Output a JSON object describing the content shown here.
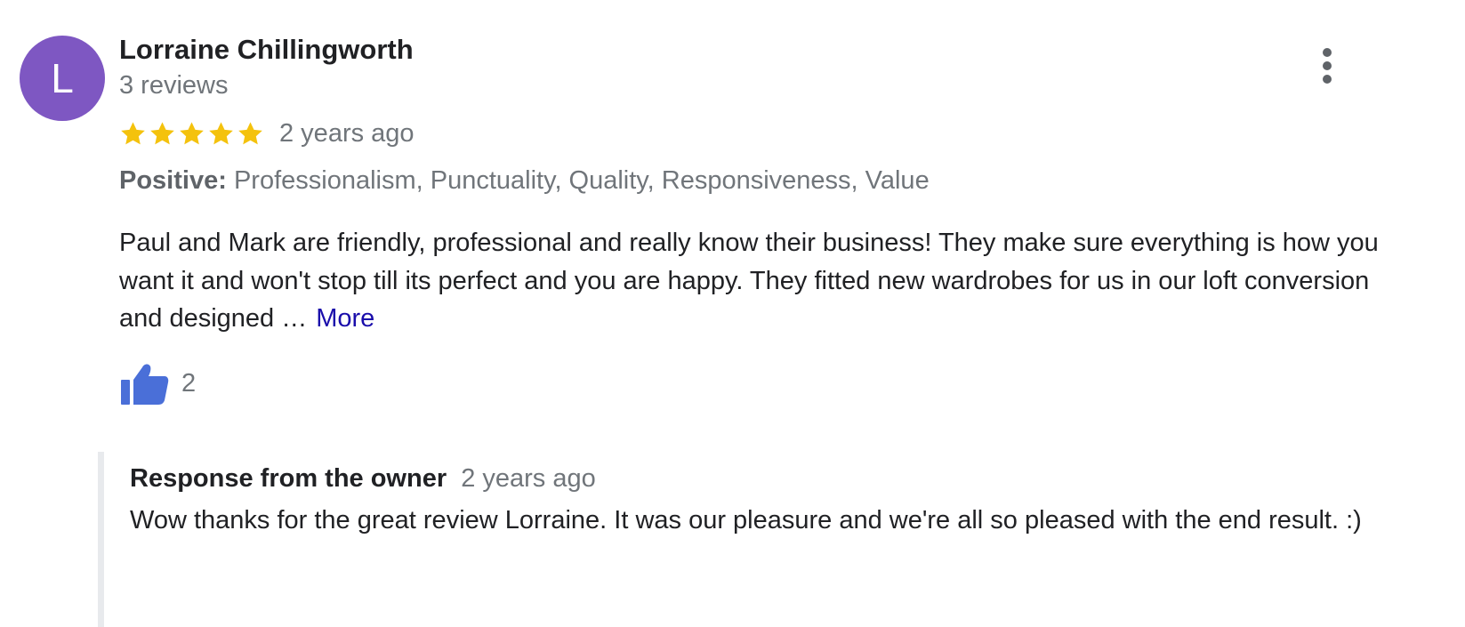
{
  "review": {
    "reviewer": {
      "avatar_initial": "L",
      "avatar_color": "#7e57c2",
      "name": "Lorraine Chillingworth",
      "review_count": "3 reviews"
    },
    "rating": {
      "stars": 5,
      "max_stars": 5,
      "star_color": "#f4c20d"
    },
    "date": "2 years ago",
    "attributes": {
      "label": "Positive:",
      "values": "Professionalism, Punctuality, Quality, Responsiveness, Value"
    },
    "text": "Paul and Mark are friendly, professional and really know their business! They make sure everything is how you want it and won't stop till its perfect and you are happy. They fitted new wardrobes for us in our loft conversion and designed …",
    "more_label": "More",
    "likes": {
      "icon": "thumbs-up-icon",
      "count": "2",
      "icon_color": "#4a6fd8"
    },
    "menu_icon": "more-vert-icon"
  },
  "owner_response": {
    "title": "Response from the owner",
    "date": "2 years ago",
    "text": "Wow thanks for the great review Lorraine. It was our pleasure and we're all so pleased with the end result. :)"
  }
}
